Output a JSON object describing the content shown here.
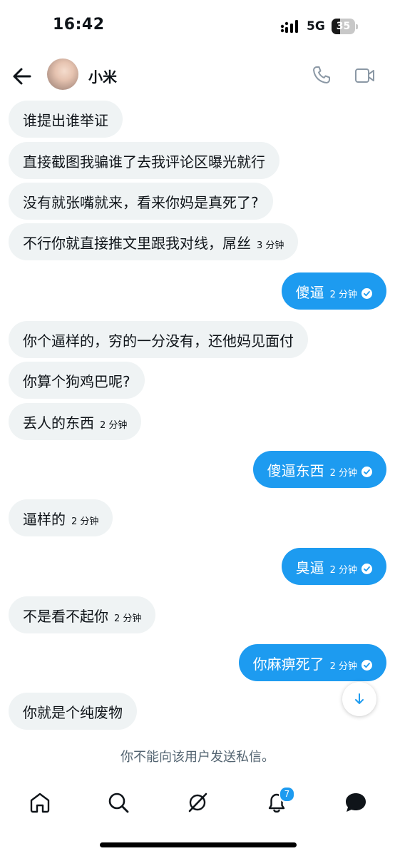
{
  "status_bar": {
    "time": "16:42",
    "network": "5G",
    "battery": 35,
    "battery_label": "35"
  },
  "header": {
    "contact_name": "小米",
    "back_icon": "arrow-left-icon",
    "call_icon": "phone-icon",
    "video_icon": "video-camera-icon"
  },
  "messages": [
    {
      "direction": "in",
      "text": "谁提出谁举证",
      "time": ""
    },
    {
      "direction": "in",
      "text": "直接截图我骗谁了去我评论区曝光就行",
      "time": ""
    },
    {
      "direction": "in",
      "text": "没有就张嘴就来，看来你妈是真死了?",
      "time": ""
    },
    {
      "direction": "in",
      "text": "不行你就直接推文里跟我对线，屌丝",
      "time": "3 分钟"
    },
    {
      "direction": "out",
      "text": "傻逼",
      "time": "2 分钟"
    },
    {
      "direction": "in",
      "text": "你个逼样的，穷的一分没有，还他妈见面付",
      "time": ""
    },
    {
      "direction": "in",
      "text": "你算个狗鸡巴呢?",
      "time": ""
    },
    {
      "direction": "in",
      "text": "丢人的东西",
      "time": "2 分钟"
    },
    {
      "direction": "out",
      "text": "傻逼东西",
      "time": "2 分钟"
    },
    {
      "direction": "in",
      "text": "逼样的",
      "time": "2 分钟"
    },
    {
      "direction": "out",
      "text": "臭逼",
      "time": "2 分钟"
    },
    {
      "direction": "in",
      "text": "不是看不起你",
      "time": "2 分钟"
    },
    {
      "direction": "out",
      "text": "你麻痹死了",
      "time": "2 分钟"
    },
    {
      "direction": "in",
      "text": "你就是个纯废物",
      "time": ""
    }
  ],
  "notice": "你不能向该用户发送私信。",
  "bottom_nav": {
    "items": [
      "home-icon",
      "search-icon",
      "grok-icon",
      "bell-icon",
      "messages-icon"
    ],
    "notification_count": "7"
  },
  "colors": {
    "accent": "#1d9bf0",
    "incoming_bubble": "#eff3f4",
    "secondary_text": "#536471"
  }
}
